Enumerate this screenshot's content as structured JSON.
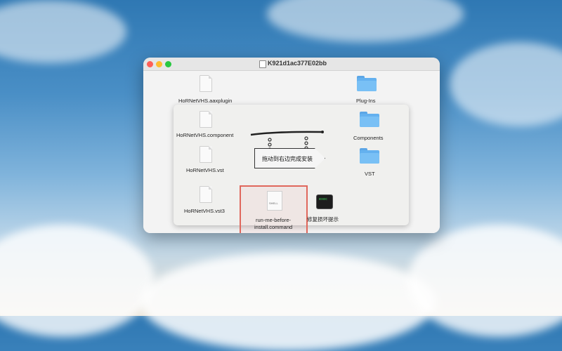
{
  "window": {
    "title": "K921d1ac377E02bb"
  },
  "files": [
    {
      "name": "HoRNetVHS.aaxplugin"
    },
    {
      "name": "HoRNetVHS.component"
    },
    {
      "name": "HoRNetVHS.vst"
    },
    {
      "name": "HoRNetVHS.vst3"
    }
  ],
  "folders": [
    {
      "name": "Plug-Ins"
    },
    {
      "name": "Components"
    },
    {
      "name": "VST"
    }
  ],
  "sign": {
    "text": "拖动到右边完成安装"
  },
  "script": {
    "name_line1": "run-me-before-",
    "name_line2": "install.command",
    "badge": "SHELL"
  },
  "repair": {
    "name": "修复损坏提示",
    "badge": "exec"
  },
  "colors": {
    "highlight": "#e0675c",
    "folder": "#64b1ef"
  }
}
